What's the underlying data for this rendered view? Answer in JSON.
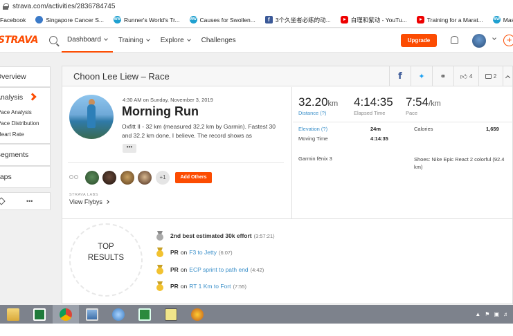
{
  "browser": {
    "url": "strava.com/activities/2836784745",
    "bookmarks": [
      {
        "label": "Facebook",
        "icon": "chrome-icon"
      },
      {
        "label": "Singapore Cancer S...",
        "icon": "website-icon"
      },
      {
        "label": "Runner's World's Tr...",
        "icon": "ww-icon"
      },
      {
        "label": "Causes for Swollen...",
        "icon": "ww-icon"
      },
      {
        "label": "3个久坐者必练的动...",
        "icon": "facebook-icon"
      },
      {
        "label": "白瑾和紫动 - YouTu...",
        "icon": "youtube-icon"
      },
      {
        "label": "Training for a Marat...",
        "icon": "youtube-icon"
      },
      {
        "label": "Masters Runners |...",
        "icon": "ww-icon"
      }
    ]
  },
  "header": {
    "logo": "STRAVA",
    "nav": [
      "Dashboard",
      "Training",
      "Explore",
      "Challenges"
    ],
    "upgrade_label": "Upgrade",
    "plus_glyph": "+"
  },
  "sidebar": {
    "overview": "Overview",
    "analysis": "Analysis",
    "sub_items": [
      "Pace Analysis",
      "Pace Distribution",
      "Heart Rate"
    ],
    "segments": "Segments",
    "laps": "Laps",
    "more_label": "•••"
  },
  "activity": {
    "header_title": "Choon Lee Liew – Race",
    "share": {
      "kudos_count": "4",
      "comment_count": "2"
    },
    "time": "4:30 AM on Sunday, November 3, 2019",
    "name": "Morning Run",
    "description": "Oxfitt II - 32 km (measured 32.2 km by Garmin). Fastest 30 and 32.2 km done, I believe. The record shows as",
    "more_btn": "•••",
    "friends_more": "+1",
    "add_others": "Add Others",
    "labs_label": "STRAVA LABS",
    "flybys_label": "View Flybys"
  },
  "stats": {
    "distance": {
      "value": "32.20",
      "unit": "km",
      "label": "Distance (?)"
    },
    "elapsed": {
      "value": "4:14:35",
      "label": "Elapsed Time"
    },
    "pace": {
      "value": "7:54",
      "unit": "/km",
      "label": "Pace"
    },
    "elevation_label": "Elevation (?)",
    "elevation_value": "24m",
    "calories_label": "Calories",
    "calories_value": "1,659",
    "moving_label": "Moving Time",
    "moving_value": "4:14:35",
    "device": "Garmin fēnix 3",
    "shoes": "Shoes: Nike Epic React 2 colorful (92.4 km)"
  },
  "results": {
    "heading_line1": "TOP",
    "heading_line2": "RESULTS",
    "items": [
      {
        "bold": "2nd best estimated 30k effort",
        "text": "",
        "link": "",
        "time": "(3:57:21)",
        "medal": "silver"
      },
      {
        "bold": "PR",
        "text": "on",
        "link": "F3 to Jetty",
        "time": "(6:07)",
        "medal": "gold"
      },
      {
        "bold": "PR",
        "text": "on",
        "link": "ECP sprint to path end",
        "time": "(4:42)",
        "medal": "gold"
      },
      {
        "bold": "PR",
        "text": "on",
        "link": "RT 1 Km to Fort",
        "time": "(7:55)",
        "medal": "gold"
      }
    ]
  },
  "colors": {
    "brand": "#fc4c02",
    "link": "#3a8fc9"
  }
}
